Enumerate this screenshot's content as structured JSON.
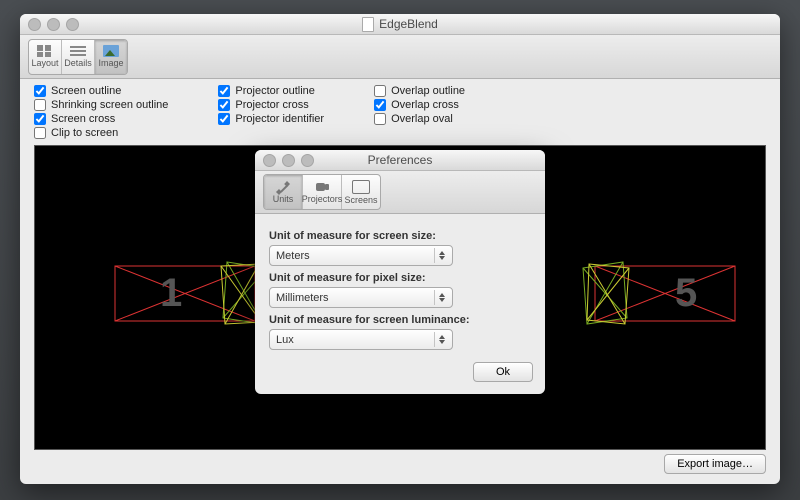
{
  "window": {
    "title": "EdgeBlend",
    "toolbar": {
      "items": [
        {
          "id": "layout",
          "label": "Layout"
        },
        {
          "id": "details",
          "label": "Details"
        },
        {
          "id": "image",
          "label": "Image"
        }
      ],
      "active": "image"
    }
  },
  "checks": {
    "col1": [
      {
        "label": "Screen outline",
        "checked": true
      },
      {
        "label": "Shrinking screen outline",
        "checked": false
      },
      {
        "label": "Screen cross",
        "checked": true
      },
      {
        "label": "Clip to screen",
        "checked": false
      }
    ],
    "col2": [
      {
        "label": "Projector outline",
        "checked": true
      },
      {
        "label": "Projector cross",
        "checked": true
      },
      {
        "label": "Projector identifier",
        "checked": true
      }
    ],
    "col3": [
      {
        "label": "Overlap outline",
        "checked": false
      },
      {
        "label": "Overlap cross",
        "checked": true
      },
      {
        "label": "Overlap oval",
        "checked": false
      }
    ]
  },
  "viewer": {
    "left_id": "1",
    "right_id": "5"
  },
  "footer": {
    "export_label": "Export image…"
  },
  "prefs": {
    "title": "Preferences",
    "tabs": [
      {
        "id": "units",
        "label": "Units"
      },
      {
        "id": "projectors",
        "label": "Projectors"
      },
      {
        "id": "screens",
        "label": "Screens"
      }
    ],
    "active": "units",
    "fields": {
      "screen_size": {
        "label": "Unit of measure for screen size:",
        "value": "Meters"
      },
      "pixel_size": {
        "label": "Unit of measure for pixel size:",
        "value": "Millimeters"
      },
      "luminance": {
        "label": "Unit of measure for screen luminance:",
        "value": "Lux"
      }
    },
    "ok_label": "Ok"
  }
}
